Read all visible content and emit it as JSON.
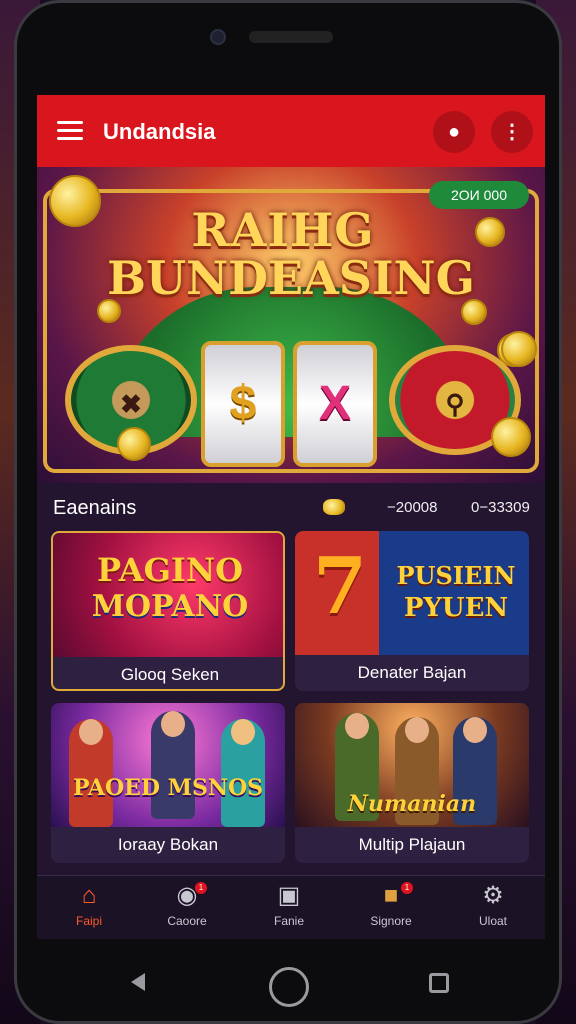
{
  "app": {
    "title": "Undandsia"
  },
  "header": {
    "account_icon": "person-icon",
    "more_icon": "more-vert-icon"
  },
  "hero": {
    "title_line1": "RAIHG",
    "title_line2": "BUNDEASING",
    "badge": "2OИ 000",
    "reel_symbol_a": "$",
    "reel_symbol_b": "X"
  },
  "stats": {
    "title": "Eaenains",
    "value_a": "−20008",
    "value_b": "0−33309"
  },
  "cards": [
    {
      "art_line1": "PAGINO",
      "art_line2": "MOPANO",
      "label": "Glooq Seken"
    },
    {
      "art_big": "7",
      "art_line1": "PUSIEIN",
      "art_line2": "PYUEN",
      "label": "Denater Bajan"
    },
    {
      "art_line1": "PAOED MSNOS",
      "label": "Ioraay Bokan"
    },
    {
      "art_line1": "Numanian",
      "label": "Multip Plajaun"
    }
  ],
  "bottom_nav": [
    {
      "label": "Faipi",
      "icon": "home-icon",
      "active": true
    },
    {
      "label": "Caoore",
      "icon": "chat-icon",
      "badge": "1"
    },
    {
      "label": "Fanie",
      "icon": "store-icon"
    },
    {
      "label": "Signore",
      "icon": "tag-icon",
      "badge": "1"
    },
    {
      "label": "Uloat",
      "icon": "settings-icon"
    }
  ],
  "colors": {
    "appbar": "#d9161e",
    "accent": "#ff5a2a",
    "badge": "#1f8a3a"
  }
}
